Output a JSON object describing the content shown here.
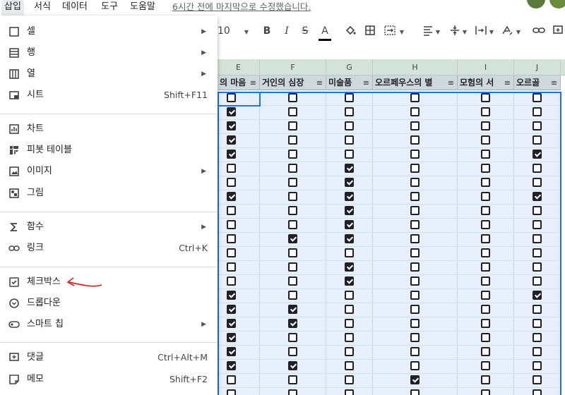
{
  "menubar": {
    "items": [
      "삽입",
      "서식",
      "데이터",
      "도구",
      "도움말"
    ],
    "last_edit": "6시간 전에 마지막으로 수정했습니다."
  },
  "toolbar": {
    "font_size": "10",
    "icons": [
      "bold-icon",
      "italic-icon",
      "strikethrough-icon",
      "text-color-icon",
      "fill-color-icon",
      "borders-icon",
      "merge-cells-icon",
      "horizontal-align-icon",
      "vertical-align-icon",
      "text-wrap-icon",
      "text-rotation-icon",
      "link-icon",
      "comment-icon"
    ]
  },
  "insert_menu": {
    "items": [
      {
        "label": "셀",
        "shortcut": "",
        "submenu": true,
        "icon": "cell-icon"
      },
      {
        "label": "행",
        "shortcut": "",
        "submenu": true,
        "icon": "row-icon"
      },
      {
        "label": "열",
        "shortcut": "",
        "submenu": true,
        "icon": "column-icon"
      },
      {
        "label": "시트",
        "shortcut": "Shift+F11",
        "submenu": false,
        "icon": "sheet-icon"
      },
      {
        "label": "차트",
        "shortcut": "",
        "submenu": false,
        "icon": "chart-icon"
      },
      {
        "label": "피봇 테이블",
        "shortcut": "",
        "submenu": false,
        "icon": "pivot-table-icon"
      },
      {
        "label": "이미지",
        "shortcut": "",
        "submenu": true,
        "icon": "image-icon"
      },
      {
        "label": "그림",
        "shortcut": "",
        "submenu": false,
        "icon": "drawing-icon"
      },
      {
        "label": "함수",
        "shortcut": "",
        "submenu": true,
        "icon": "function-icon"
      },
      {
        "label": "링크",
        "shortcut": "Ctrl+K",
        "submenu": false,
        "icon": "link-icon"
      },
      {
        "label": "체크박스",
        "shortcut": "",
        "submenu": false,
        "icon": "checkbox-icon"
      },
      {
        "label": "드롭다운",
        "shortcut": "",
        "submenu": false,
        "icon": "dropdown-icon"
      },
      {
        "label": "스마트 칩",
        "shortcut": "",
        "submenu": true,
        "icon": "smart-chip-icon"
      },
      {
        "label": "댓글",
        "shortcut": "Ctrl+Alt+M",
        "submenu": false,
        "icon": "comment-icon"
      },
      {
        "label": "메모",
        "shortcut": "Shift+F2",
        "submenu": false,
        "icon": "note-icon"
      }
    ]
  },
  "grid": {
    "columns": [
      {
        "letter": "E",
        "header": "의 마음"
      },
      {
        "letter": "F",
        "header": "거인의 심장"
      },
      {
        "letter": "G",
        "header": "미술품"
      },
      {
        "letter": "H",
        "header": "오르페우스의 별"
      },
      {
        "letter": "I",
        "header": "모험의 서"
      },
      {
        "letter": "J",
        "header": "오르골"
      }
    ],
    "rows": [
      [
        0,
        0,
        0,
        0,
        0,
        0
      ],
      [
        1,
        0,
        0,
        0,
        0,
        0
      ],
      [
        1,
        0,
        0,
        0,
        0,
        0
      ],
      [
        1,
        0,
        0,
        0,
        0,
        0
      ],
      [
        1,
        0,
        0,
        0,
        0,
        1
      ],
      [
        0,
        0,
        1,
        0,
        0,
        0
      ],
      [
        0,
        0,
        1,
        0,
        0,
        0
      ],
      [
        1,
        0,
        1,
        0,
        0,
        1
      ],
      [
        0,
        0,
        1,
        0,
        0,
        0
      ],
      [
        0,
        0,
        1,
        0,
        0,
        0
      ],
      [
        0,
        1,
        1,
        0,
        0,
        0
      ],
      [
        0,
        0,
        0,
        0,
        0,
        0
      ],
      [
        0,
        0,
        1,
        0,
        0,
        0
      ],
      [
        0,
        0,
        1,
        0,
        0,
        0
      ],
      [
        1,
        0,
        0,
        0,
        0,
        1
      ],
      [
        1,
        1,
        0,
        0,
        0,
        0
      ],
      [
        1,
        1,
        0,
        0,
        0,
        0
      ],
      [
        1,
        0,
        0,
        0,
        0,
        0
      ],
      [
        1,
        0,
        0,
        0,
        0,
        0
      ],
      [
        1,
        1,
        0,
        0,
        0,
        0
      ],
      [
        0,
        0,
        0,
        1,
        0,
        0
      ],
      [
        0,
        0,
        0,
        0,
        0,
        0
      ]
    ]
  }
}
